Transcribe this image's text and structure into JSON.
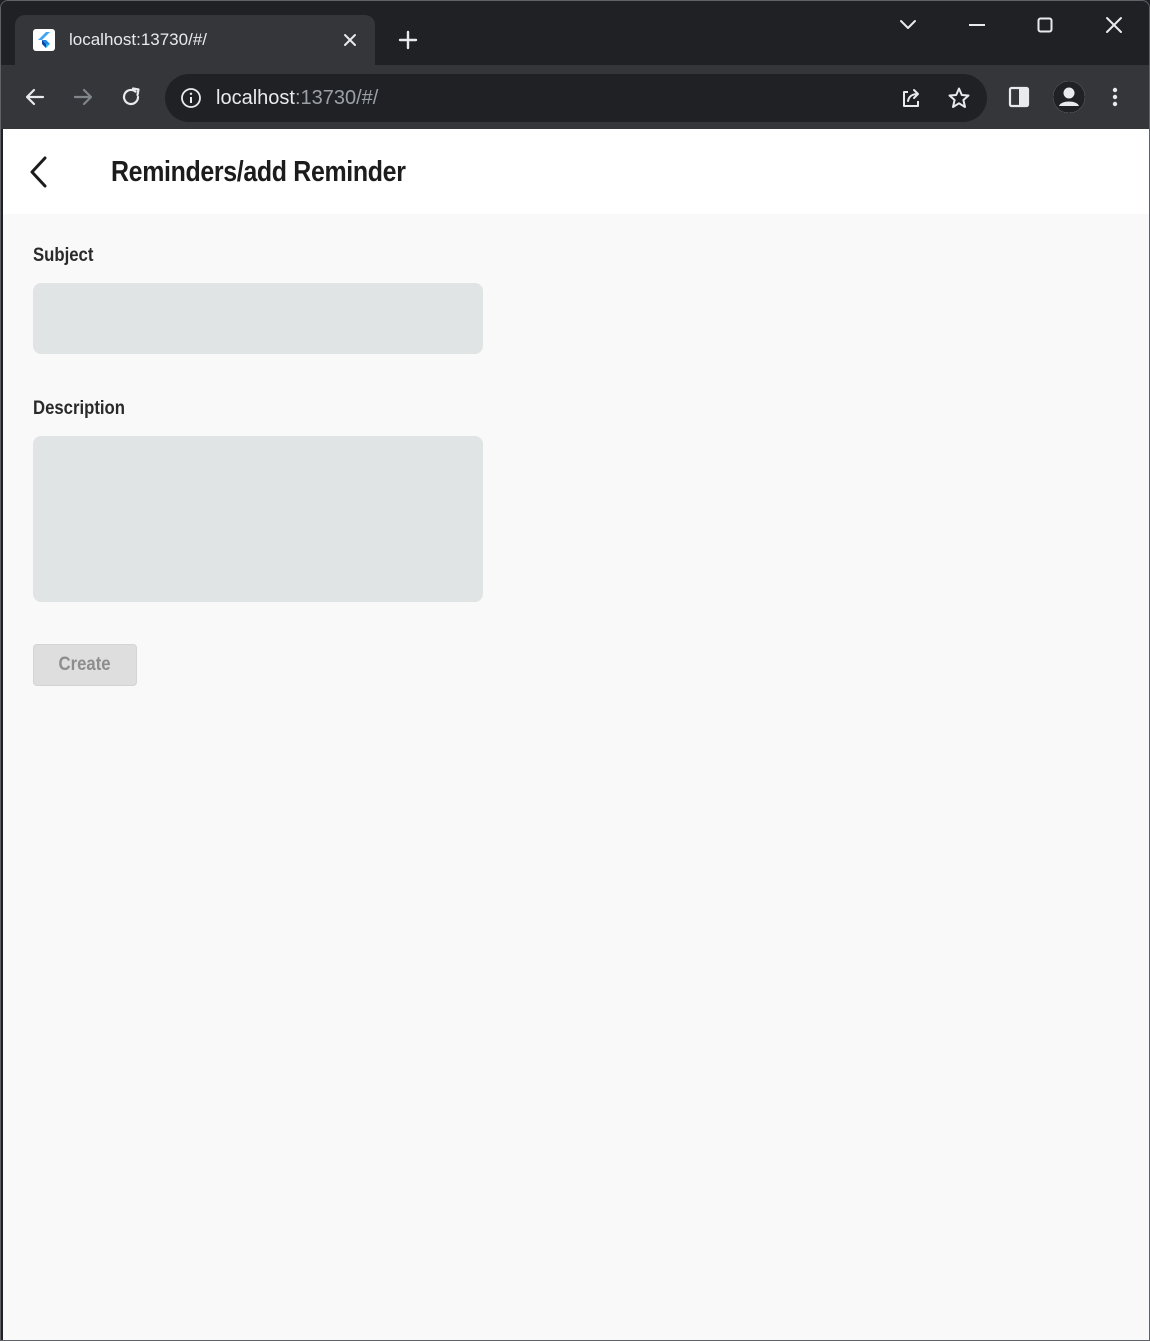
{
  "browser": {
    "tab": {
      "title": "localhost:13730/#/",
      "favicon": "flutter-icon"
    },
    "window_controls": [
      "tab-search-icon",
      "minimize-icon",
      "maximize-icon",
      "close-icon"
    ],
    "toolbar": {
      "url_host": "localhost",
      "url_rest": ":13730/#/",
      "icons": [
        "back-icon",
        "forward-icon",
        "reload-icon",
        "site-info-icon",
        "share-icon",
        "bookmark-star-icon",
        "side-panel-icon",
        "profile-icon",
        "menu-icon"
      ]
    }
  },
  "app": {
    "header": {
      "title": "Reminders/add Reminder",
      "back_icon": "chevron-left-icon"
    },
    "form": {
      "subject_label": "Subject",
      "subject_value": "",
      "description_label": "Description",
      "description_value": "",
      "create_label": "Create"
    }
  },
  "colors": {
    "browser_frame": "#202124",
    "toolbar": "#35363a",
    "page_background": "#f9f9f9",
    "appbar_background": "#ffffff",
    "input_fill": "#e1e4e5",
    "button_disabled_fill": "#dedede",
    "button_disabled_text": "#8d8d8d"
  }
}
